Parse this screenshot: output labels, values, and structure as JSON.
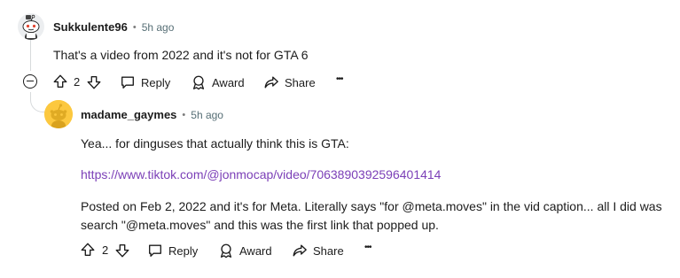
{
  "comment1": {
    "username": "Sukkulente96",
    "separator": "•",
    "time": "5h ago",
    "body": "That's a video from 2022 and it's not for GTA 6",
    "vote_count": "2",
    "actions": {
      "reply": "Reply",
      "award": "Award",
      "share": "Share",
      "more": "•••"
    }
  },
  "comment2": {
    "username": "madame_gaymes",
    "separator": "•",
    "time": "5h ago",
    "body_line1": "Yea... for dinguses that actually think this is GTA:",
    "link": "https://www.tiktok.com/@jonmocap/video/7063890392596401414",
    "body_line3a": "Posted on Feb 2, 2022 and it's for Meta. Literally says \"for @meta.moves\" in the vid caption... all I did was",
    "body_line3b": "search \"@meta.moves\" and this was the first link that popped up.",
    "vote_count": "2",
    "actions": {
      "reply": "Reply",
      "award": "Award",
      "share": "Share",
      "more": "•••"
    }
  },
  "colors": {
    "link": "#7b3fb7",
    "avatar_bg": "#fcc83f",
    "thread_line": "#d7dadc"
  }
}
